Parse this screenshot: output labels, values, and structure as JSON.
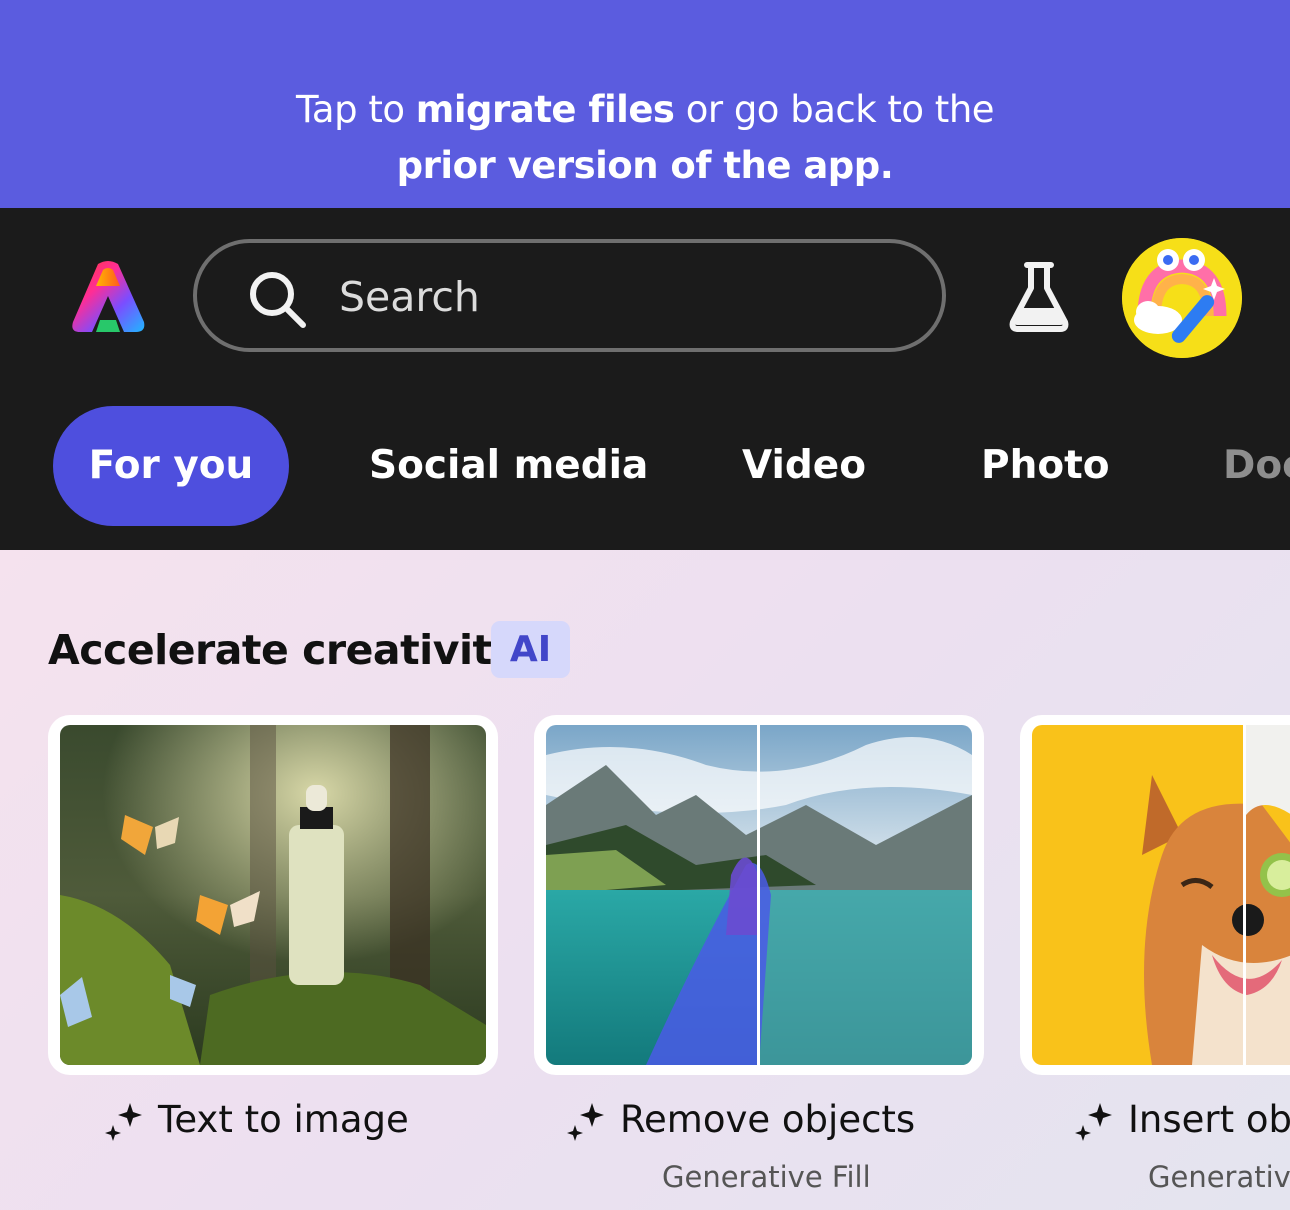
{
  "banner": {
    "line1_pre": "Tap to ",
    "line1_bold": "migrate files",
    "line1_post": " or go back to the",
    "line2_bold": "prior version of the app."
  },
  "search": {
    "placeholder": "Search"
  },
  "tabs": [
    {
      "label": "For you",
      "active": true
    },
    {
      "label": "Social media",
      "active": false
    },
    {
      "label": "Video",
      "active": false
    },
    {
      "label": "Photo",
      "active": false
    },
    {
      "label": "Doc",
      "active": false
    }
  ],
  "section": {
    "title": "Accelerate creativity",
    "badge": "AI"
  },
  "cards": [
    {
      "title": "Text to image",
      "subtitle": ""
    },
    {
      "title": "Remove objects",
      "subtitle": "Generative Fill"
    },
    {
      "title": "Insert obj",
      "subtitle": "Generative"
    }
  ],
  "icons": {
    "logo": "adobe-express-logo-icon",
    "search": "search-icon",
    "labs": "flask-icon",
    "avatar": "avatar",
    "sparkle": "sparkle-icon"
  },
  "colors": {
    "banner_bg": "#5b5cdf",
    "header_bg": "#1b1b1b",
    "active_tab": "#4e4fde",
    "ai_badge_bg": "#d6d8fb",
    "ai_badge_text": "#4246c9"
  }
}
